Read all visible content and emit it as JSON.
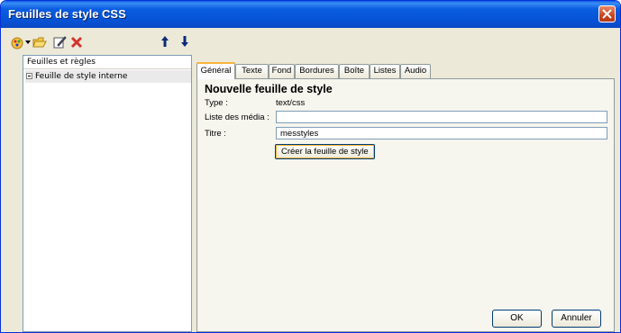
{
  "window": {
    "title": "Feuilles de style CSS"
  },
  "left_panel": {
    "header": "Feuilles et règles",
    "tree": [
      {
        "label": "Feuille de style interne"
      }
    ]
  },
  "toolbar_icons": [
    "new-sheet-icon",
    "dropdown-arrow-icon",
    "open-folder-icon",
    "edit-icon",
    "delete-icon",
    "move-up-icon",
    "move-down-icon"
  ],
  "tabs": [
    {
      "label": "Général",
      "active": true
    },
    {
      "label": "Texte"
    },
    {
      "label": "Fond"
    },
    {
      "label": "Bordures"
    },
    {
      "label": "Boîte"
    },
    {
      "label": "Listes"
    },
    {
      "label": "Audio"
    }
  ],
  "form": {
    "heading": "Nouvelle feuille de style",
    "type_label": "Type :",
    "type_value": "text/css",
    "media_label": "Liste des média :",
    "media_value": "",
    "title_label": "Titre :",
    "title_value": "messtyles",
    "create_button": "Créer la feuille de style"
  },
  "buttons": {
    "ok": "OK",
    "cancel": "Annuler"
  },
  "colors": {
    "titlebar": "#0a5de0",
    "window_bg": "#ece9d8",
    "close": "#c8451f",
    "tab_highlight": "#f7b439"
  }
}
